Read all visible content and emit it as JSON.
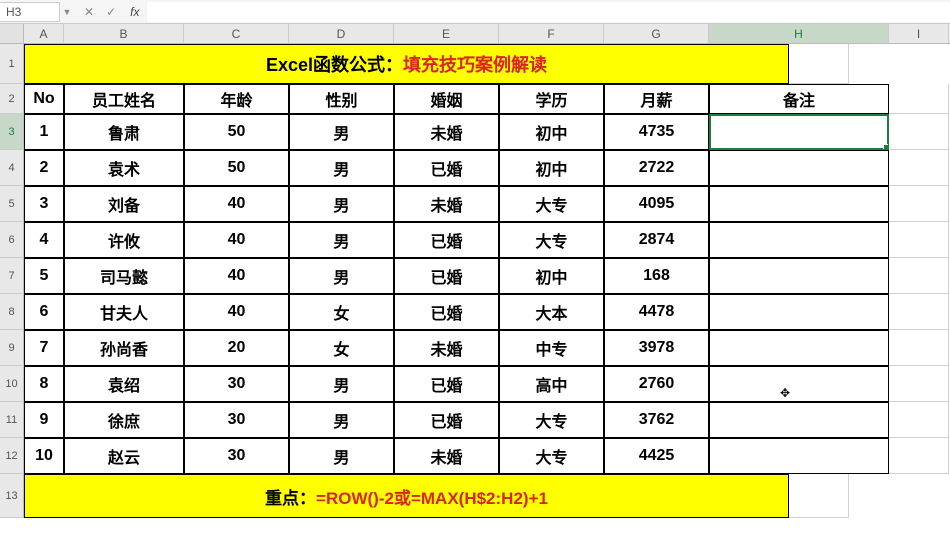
{
  "nameBox": "H3",
  "formulaBar": {
    "cancel": "✕",
    "confirm": "✓",
    "fx": "fx",
    "value": ""
  },
  "columns": [
    "A",
    "B",
    "C",
    "D",
    "E",
    "F",
    "G",
    "H",
    "I"
  ],
  "titleRow": {
    "prefix": "Excel函数公式：",
    "suffix": "填充技巧案例解读"
  },
  "headers": {
    "no": "No",
    "name": "员工姓名",
    "age": "年龄",
    "gender": "性别",
    "marriage": "婚姻",
    "education": "学历",
    "salary": "月薪",
    "remark": "备注"
  },
  "rows": [
    {
      "no": "1",
      "name": "鲁肃",
      "age": "50",
      "gender": "男",
      "marriage": "未婚",
      "education": "初中",
      "salary": "4735",
      "remark": ""
    },
    {
      "no": "2",
      "name": "袁术",
      "age": "50",
      "gender": "男",
      "marriage": "已婚",
      "education": "初中",
      "salary": "2722",
      "remark": ""
    },
    {
      "no": "3",
      "name": "刘备",
      "age": "40",
      "gender": "男",
      "marriage": "未婚",
      "education": "大专",
      "salary": "4095",
      "remark": ""
    },
    {
      "no": "4",
      "name": "许攸",
      "age": "40",
      "gender": "男",
      "marriage": "已婚",
      "education": "大专",
      "salary": "2874",
      "remark": ""
    },
    {
      "no": "5",
      "name": "司马懿",
      "age": "40",
      "gender": "男",
      "marriage": "已婚",
      "education": "初中",
      "salary": "168",
      "remark": ""
    },
    {
      "no": "6",
      "name": "甘夫人",
      "age": "40",
      "gender": "女",
      "marriage": "已婚",
      "education": "大本",
      "salary": "4478",
      "remark": ""
    },
    {
      "no": "7",
      "name": "孙尚香",
      "age": "20",
      "gender": "女",
      "marriage": "未婚",
      "education": "中专",
      "salary": "3978",
      "remark": ""
    },
    {
      "no": "8",
      "name": "袁绍",
      "age": "30",
      "gender": "男",
      "marriage": "已婚",
      "education": "高中",
      "salary": "2760",
      "remark": ""
    },
    {
      "no": "9",
      "name": "徐庶",
      "age": "30",
      "gender": "男",
      "marriage": "已婚",
      "education": "大专",
      "salary": "3762",
      "remark": ""
    },
    {
      "no": "10",
      "name": "赵云",
      "age": "30",
      "gender": "男",
      "marriage": "未婚",
      "education": "大专",
      "salary": "4425",
      "remark": ""
    }
  ],
  "footer": {
    "prefix": "重点：",
    "formula": "=ROW()-2或=MAX(H$2:H2)+1"
  },
  "activeCell": "H3",
  "cursorGlyph": "✥"
}
